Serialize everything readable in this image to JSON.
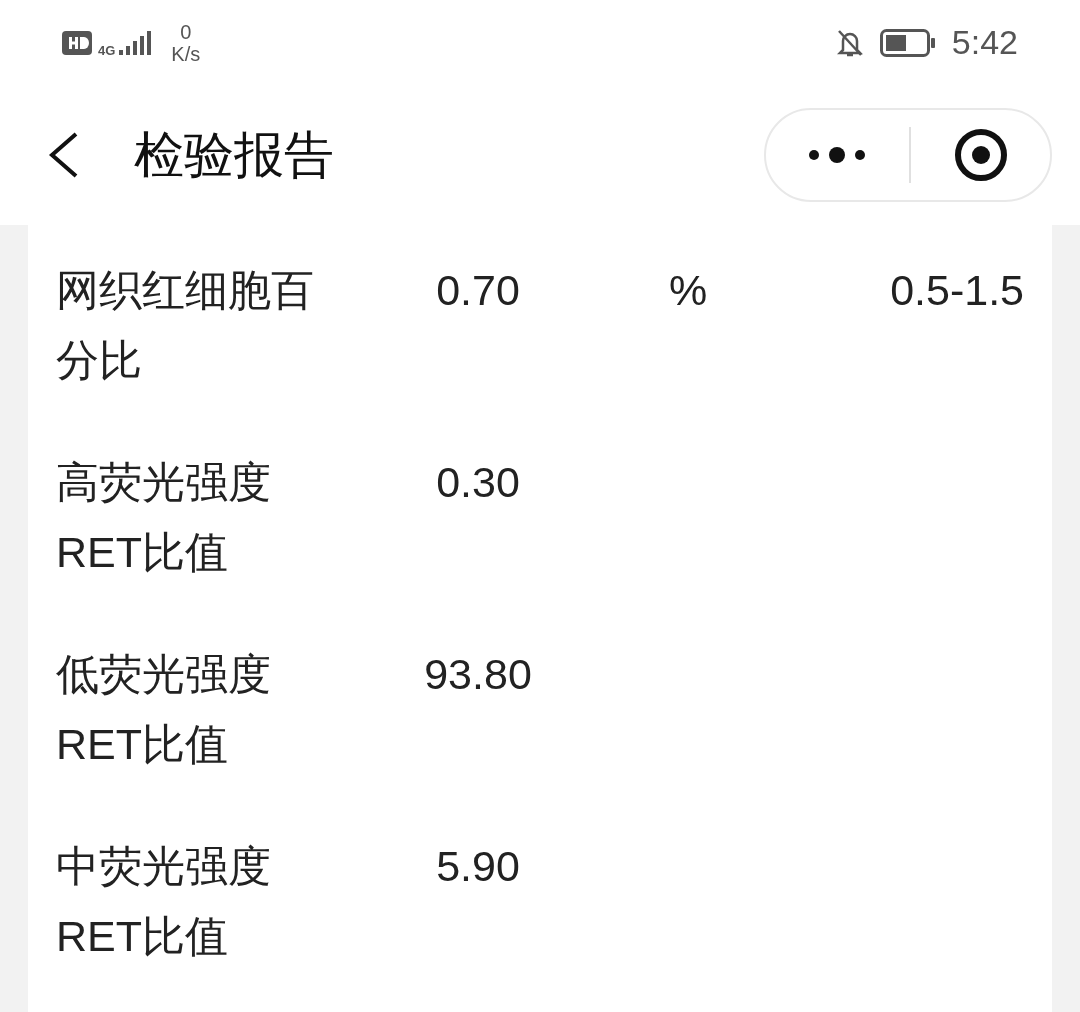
{
  "status_bar": {
    "network": "4G",
    "speed_value": "0",
    "speed_unit": "K/s",
    "time": "5:42"
  },
  "nav": {
    "title": "检验报告"
  },
  "rows": [
    {
      "name": "网织红细胞百分比",
      "value": "0.70",
      "unit": "%",
      "range": "0.5-1.5"
    },
    {
      "name": "高荧光强度RET比值",
      "value": "0.30"
    },
    {
      "name": "低荧光强度RET比值",
      "value": "93.80"
    },
    {
      "name": "中荧光强度RET比值",
      "value": "5.90"
    }
  ]
}
